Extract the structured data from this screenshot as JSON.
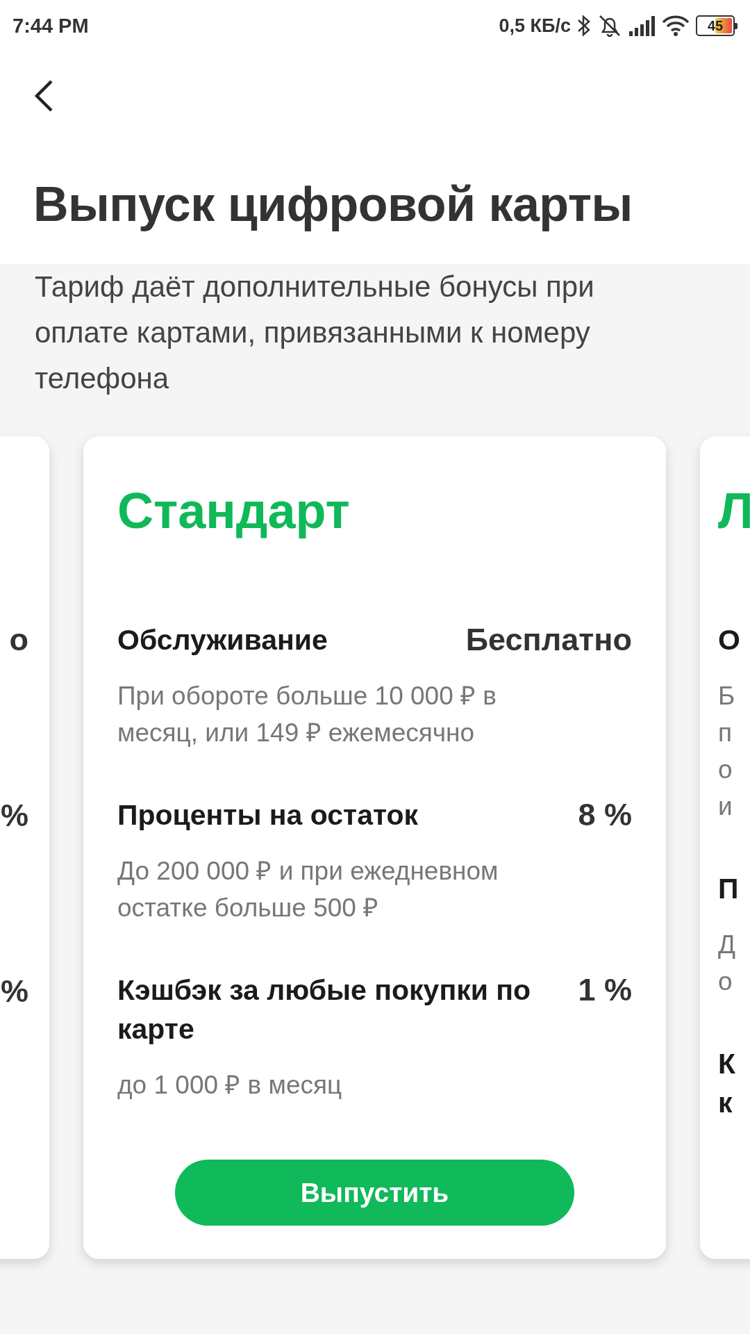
{
  "status_bar": {
    "time": "7:44 PM",
    "speed": "0,5 КБ/с",
    "battery": "45"
  },
  "header": {
    "title": "Выпуск цифровой карты"
  },
  "subtitle": "Тариф даёт дополнительные бонусы при оплате картами, привязанными к номеру телефона",
  "cards": [
    {
      "kind": "left",
      "rows": [
        {
          "value": "о"
        },
        {
          "value": "%"
        },
        {
          "value": "%"
        }
      ]
    },
    {
      "kind": "full",
      "title": "Стандарт",
      "rows": [
        {
          "title": [
            "Обслуживание"
          ],
          "value": "Бесплатно",
          "notes": [
            "При обороте больше 10 000 ₽ в месяц, или 149 ₽ ежемесячно"
          ]
        },
        {
          "title": [
            "Проценты на остаток"
          ],
          "value": "8 %",
          "notes": [
            "До 200 000 ₽ и при ежедневном остатке больше 500 ₽"
          ]
        },
        {
          "title": [
            "Кэшбэк за любые покупки по карте"
          ],
          "value": "1 %",
          "notes": [
            "до 1 000 ₽ в месяц"
          ]
        }
      ],
      "button": "Выпустить"
    },
    {
      "kind": "right",
      "title": "Л",
      "rows": [
        {
          "title": [
            "О"
          ],
          "notes": [
            "Б",
            "п",
            "о",
            "и"
          ]
        },
        {
          "title": [
            "П"
          ],
          "notes": [
            "Д",
            "о"
          ]
        },
        {
          "title": [
            "К",
            "к"
          ]
        }
      ]
    }
  ]
}
